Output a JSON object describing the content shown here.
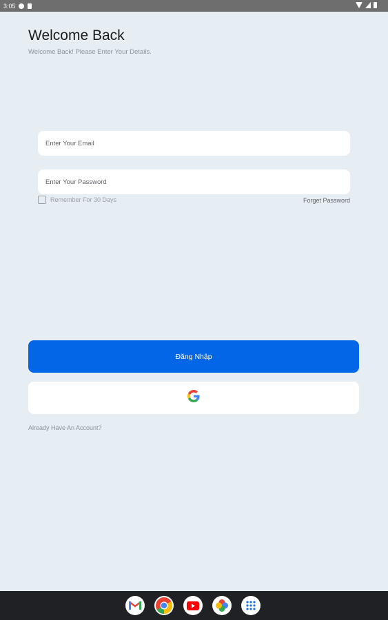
{
  "status_bar": {
    "time": "3:05"
  },
  "header": {
    "title": "Welcome Back",
    "subtitle": "Welcome Back! Please Enter Your Details."
  },
  "form": {
    "email_placeholder": "Enter Your Email",
    "password_placeholder": "Enter Your Password",
    "remember_label": "Remember For 30 Days",
    "forgot_label": "Forget Password"
  },
  "actions": {
    "login_label": "Đăng Nhập",
    "google_icon": "google-icon",
    "account_link": "Already Have An Account?"
  },
  "dock": {
    "apps": [
      "gmail-icon",
      "chrome-icon",
      "youtube-icon",
      "photos-icon",
      "app-drawer-icon"
    ]
  },
  "colors": {
    "primary": "#0366e6",
    "background": "#e6eef4",
    "field_bg": "#ffffff"
  }
}
